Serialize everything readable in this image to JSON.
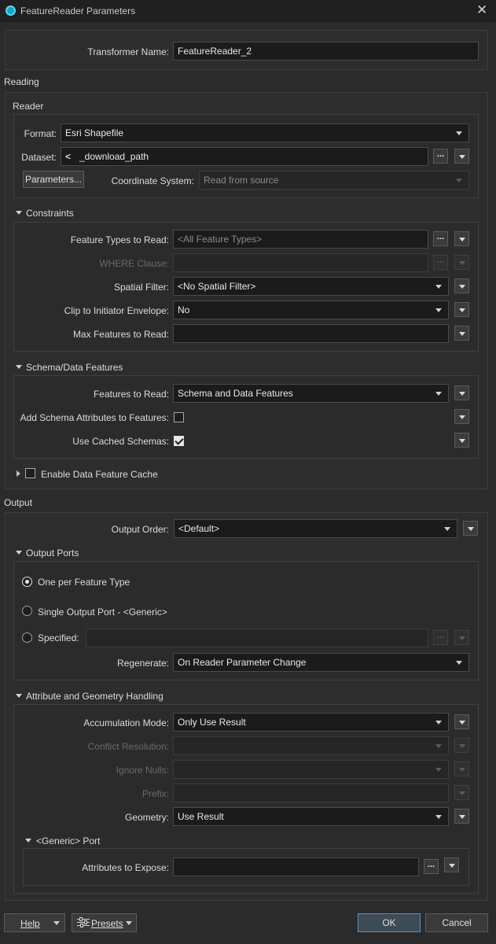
{
  "window": {
    "title": "FeatureReader Parameters"
  },
  "transformer_name": {
    "label": "Transformer Name:",
    "value": "FeatureReader_2"
  },
  "reading": {
    "title": "Reading",
    "reader": {
      "title": "Reader",
      "format_label": "Format:",
      "format_value": "Esri Shapefile",
      "dataset_label": "Dataset:",
      "dataset_value": "_download_path",
      "parameters_button": "Parameters...",
      "coord_label": "Coordinate System:",
      "coord_placeholder": "Read from source"
    },
    "constraints": {
      "title": "Constraints",
      "feature_types_label": "Feature Types to Read:",
      "feature_types_placeholder": "<All Feature Types>",
      "where_label": "WHERE Clause:",
      "spatial_label": "Spatial Filter:",
      "spatial_value": "<No Spatial Filter>",
      "clip_label": "Clip to Initiator Envelope:",
      "clip_value": "No",
      "max_label": "Max Features to Read:",
      "max_value": ""
    },
    "schema": {
      "title": "Schema/Data Features",
      "features_label": "Features to Read:",
      "features_value": "Schema and Data Features",
      "add_schema_label": "Add Schema Attributes to Features:",
      "add_schema_checked": false,
      "cached_label": "Use Cached Schemas:",
      "cached_checked": true
    },
    "cache": {
      "label": "Enable Data Feature Cache",
      "checked": false
    }
  },
  "output": {
    "title": "Output",
    "order_label": "Output Order:",
    "order_value": "<Default>",
    "ports": {
      "title": "Output Ports",
      "opt_one": "One per Feature Type",
      "opt_single": "Single Output Port - <Generic>",
      "opt_specified": "Specified:",
      "selected": "One per Feature Type",
      "regenerate_label": "Regenerate:",
      "regenerate_value": "On Reader Parameter Change"
    },
    "attr": {
      "title": "Attribute and Geometry Handling",
      "accum_label": "Accumulation Mode:",
      "accum_value": "Only Use Result",
      "conflict_label": "Conflict Resolution:",
      "nulls_label": "Ignore Nulls:",
      "prefix_label": "Prefix:",
      "geometry_label": "Geometry:",
      "geometry_value": "Use Result",
      "generic_port": {
        "title": "<Generic> Port",
        "attrs_label": "Attributes to Expose:",
        "attrs_value": ""
      }
    }
  },
  "footer": {
    "help": "Help",
    "presets": "Presets",
    "ok": "OK",
    "cancel": "Cancel"
  },
  "colors": {
    "accent": "#0ea5c6",
    "ok_border": "#5f90b8"
  }
}
